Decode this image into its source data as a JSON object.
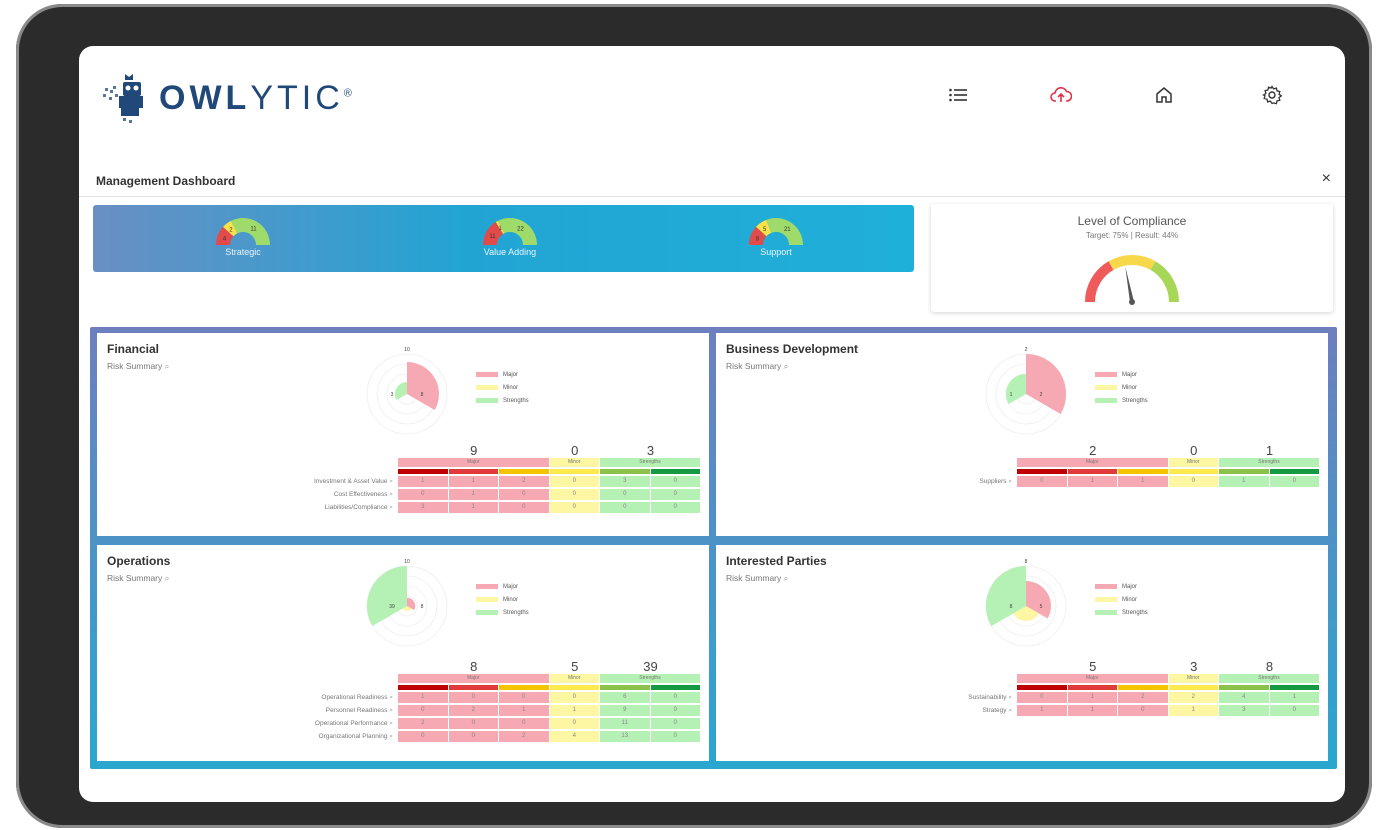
{
  "app": {
    "logo_text_bold": "OWL",
    "logo_text_light": "YTIC",
    "logo_reg": "®"
  },
  "topbar": {
    "icons": [
      "list-icon",
      "cloud-upload-icon",
      "home-icon",
      "gear-icon"
    ]
  },
  "page": {
    "title": "Management Dashboard",
    "close_symbol": "×"
  },
  "process_gauges": [
    {
      "label": "Strategic",
      "red": 4,
      "yellow": 2,
      "green": 11
    },
    {
      "label": "Value Adding",
      "red": 11,
      "yellow": 1,
      "green": 22
    },
    {
      "label": "Support",
      "red": 8,
      "yellow": 5,
      "green": 21
    }
  ],
  "compliance": {
    "title": "Level of Compliance",
    "subtitle": "Target: 75% | Result: 44%",
    "target_pct": 75,
    "result_pct": 44
  },
  "legend": {
    "major": "Major",
    "minor": "Minor",
    "strengths": "Strengths"
  },
  "colors": {
    "major": "#f6a9b2",
    "minor": "#fdf6a3",
    "strengths": "#b5f0b5",
    "sev": [
      "#c00000",
      "#e03a3a",
      "#f5c400",
      "#ffe94d",
      "#8bc34a",
      "#139a43"
    ]
  },
  "panels": [
    {
      "title": "Financial",
      "subtitle": "Risk Summary",
      "polar": {
        "max": 10,
        "major": 8,
        "minor": 0,
        "strengths": 3
      },
      "polar_labels": {
        "max": "10",
        "major": "8",
        "strengths": "3"
      },
      "totals": {
        "major": "9",
        "minor": "0",
        "strengths": "3"
      },
      "headers": {
        "major": "Major",
        "minor": "Minor",
        "strengths": "Strengths"
      },
      "rows": [
        {
          "label": "Investment & Asset Value",
          "values": [
            "1",
            "1",
            "2",
            "0",
            "3",
            "0"
          ]
        },
        {
          "label": "Cost Effectiveness",
          "values": [
            "0",
            "1",
            "0",
            "0",
            "0",
            "0"
          ]
        },
        {
          "label": "Liabilities/Compliance",
          "values": [
            "3",
            "1",
            "0",
            "0",
            "0",
            "0"
          ]
        }
      ]
    },
    {
      "title": "Business Development",
      "subtitle": "Risk Summary",
      "polar": {
        "max": 2,
        "major": 2,
        "minor": 0,
        "strengths": 1
      },
      "polar_labels": {
        "max": "2",
        "major": "2",
        "strengths": "1"
      },
      "totals": {
        "major": "2",
        "minor": "0",
        "strengths": "1"
      },
      "headers": {
        "major": "Major",
        "minor": "Minor",
        "strengths": "Strengths"
      },
      "rows": [
        {
          "label": "Suppliers",
          "values": [
            "0",
            "1",
            "1",
            "0",
            "1",
            "0"
          ]
        }
      ]
    },
    {
      "title": "Operations",
      "subtitle": "Risk Summary",
      "polar": {
        "max": 39,
        "major": 8,
        "minor": 5,
        "strengths": 39
      },
      "polar_labels": {
        "max": "10",
        "major": "8",
        "strengths": "39"
      },
      "totals": {
        "major": "8",
        "minor": "5",
        "strengths": "39"
      },
      "headers": {
        "major": "Major",
        "minor": "Minor",
        "strengths": "Strengths"
      },
      "rows": [
        {
          "label": "Operational Readiness",
          "values": [
            "1",
            "0",
            "0",
            "0",
            "6",
            "0"
          ]
        },
        {
          "label": "Personnel Readiness",
          "values": [
            "0",
            "2",
            "1",
            "1",
            "9",
            "0"
          ]
        },
        {
          "label": "Operational Performance",
          "values": [
            "2",
            "0",
            "0",
            "0",
            "11",
            "0"
          ]
        },
        {
          "label": "Organizational Planning",
          "values": [
            "0",
            "0",
            "2",
            "4",
            "13",
            "0"
          ]
        }
      ]
    },
    {
      "title": "Interested Parties",
      "subtitle": "Risk Summary",
      "polar": {
        "max": 8,
        "major": 5,
        "minor": 3,
        "strengths": 8
      },
      "polar_labels": {
        "max": "8",
        "major": "5",
        "strengths": "8"
      },
      "totals": {
        "major": "5",
        "minor": "3",
        "strengths": "8"
      },
      "headers": {
        "major": "Major",
        "minor": "Minor",
        "strengths": "Strengths"
      },
      "rows": [
        {
          "label": "Sustainability",
          "values": [
            "0",
            "1",
            "2",
            "2",
            "4",
            "1"
          ]
        },
        {
          "label": "Strategy",
          "values": [
            "1",
            "1",
            "0",
            "1",
            "3",
            "0"
          ]
        }
      ]
    }
  ]
}
